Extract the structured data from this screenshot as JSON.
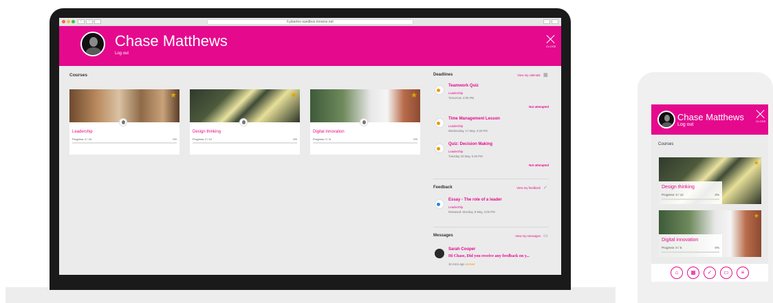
{
  "browser": {
    "url": "lt.pbartov-sandbox.mroens.net"
  },
  "user": {
    "name": "Chase Matthews",
    "logout_label": "Log out",
    "close_label": "CLOSE"
  },
  "courses": {
    "heading": "Courses",
    "items": [
      {
        "title": "Leadership",
        "progress": "Progress: 0 / 24",
        "percent": "0%"
      },
      {
        "title": "Design thinking",
        "progress": "Progress: 0 / 12",
        "percent": "0%"
      },
      {
        "title": "Digital innovation",
        "progress": "Progress: 0 / 6",
        "percent": "0%"
      }
    ]
  },
  "deadlines": {
    "heading": "Deadlines",
    "link": "View my calendar",
    "items": [
      {
        "title": "Teamwork Quiz",
        "course": "Leadership",
        "time": "Tomorrow, 4:05 PM",
        "status": "Not attempted"
      },
      {
        "title": "Time Management Lesson",
        "course": "Leadership",
        "time": "Wednesday, 17 May, 4:30 PM",
        "status": ""
      },
      {
        "title": "Quiz: Decision Making",
        "course": "Leadership",
        "time": "Tuesday 23 May, 5:40 PM",
        "status": "Not attempted"
      }
    ]
  },
  "feedback": {
    "heading": "Feedback",
    "link": "View my feedback",
    "items": [
      {
        "title": "Essay - The role of a leader",
        "course": "Leadership",
        "time": "Released: Monday, 8 May, 4:00 PM"
      }
    ]
  },
  "messages": {
    "heading": "Messages",
    "link": "View my messages",
    "items": [
      {
        "sender": "Sarah Cooper",
        "text": "Hi Chase, Did you receive any feedback on y...",
        "time": "16 mins ago",
        "status": "unread"
      }
    ]
  },
  "mobile": {
    "courses_heading": "Courses",
    "cards": [
      {
        "title": "Design thinking",
        "progress": "Progress: 0 / 12",
        "percent": "0%"
      },
      {
        "title": "Digital innovation",
        "progress": "Progress: 0 / 6",
        "percent": "0%"
      }
    ],
    "nav_icons": [
      "courses-icon",
      "calendar-icon",
      "check-icon",
      "messages-icon",
      "feedback-icon"
    ]
  },
  "colors": {
    "brand": "#e5098e",
    "star": "#e2a300",
    "deadline_icon": "#f0960a",
    "feedback_icon": "#1e88e5"
  }
}
